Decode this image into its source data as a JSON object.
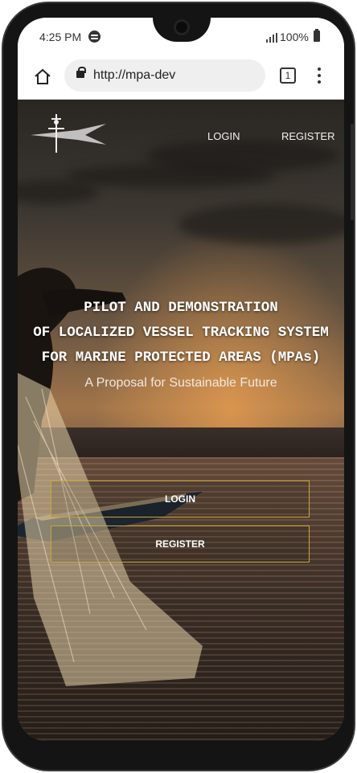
{
  "status_bar": {
    "time": "4:25 PM",
    "battery": "100%"
  },
  "browser": {
    "url": "http://mpa-dev",
    "tab_count": "1"
  },
  "nav": {
    "login": "LOGIN",
    "register": "REGISTER"
  },
  "hero": {
    "title_lines": [
      "PILOT AND DEMONSTRATION",
      "OF LOCALIZED VESSEL TRACKING SYSTEM",
      "FOR MARINE PROTECTED AREAS (MPAs)"
    ],
    "subtitle": "A Proposal for Sustainable Future"
  },
  "buttons": {
    "login": "LOGIN",
    "register": "REGISTER"
  },
  "colors": {
    "button_border": "#c9a53a",
    "accent_text": "#ffffff"
  }
}
